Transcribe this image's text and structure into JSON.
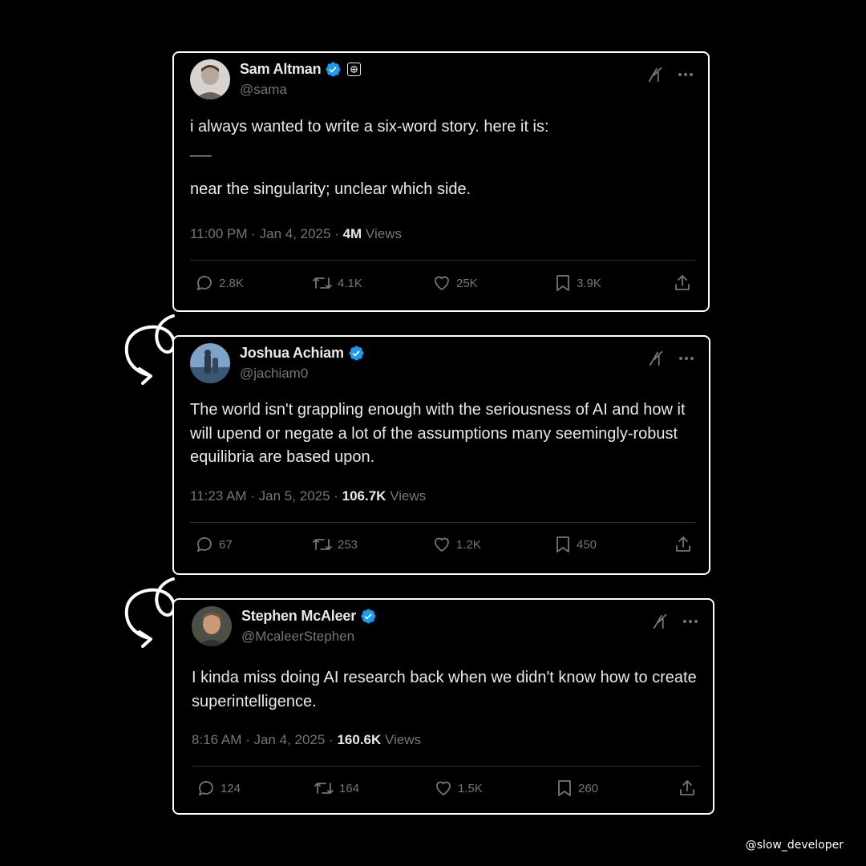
{
  "watermark": "@slow_developer",
  "tweets": [
    {
      "name": "Sam Altman",
      "handle": "@sama",
      "text_lines": [
        "i always wanted to write a six-word story. here it is:",
        "___",
        "near the singularity; unclear which side."
      ],
      "time": "11:00 PM · Jan 4, 2025 · ",
      "views_count": "4M",
      "views_label": " Views",
      "replies": "2.8K",
      "reposts": "4.1K",
      "likes": "25K",
      "bookmarks": "3.9K",
      "has_org_badge": true,
      "avatar_palette": [
        "#d9d3cf",
        "#4a3a33"
      ]
    },
    {
      "name": "Joshua Achiam",
      "handle": "@jachiam0",
      "text": "The world isn't grappling enough with the seriousness of AI and how it will upend or negate a lot of the assumptions many seemingly-robust equilibria are based upon.",
      "time": "11:23 AM · Jan 5, 2025 · ",
      "views_count": "106.7K",
      "views_label": " Views",
      "replies": "67",
      "reposts": "253",
      "likes": "1.2K",
      "bookmarks": "450",
      "avatar_palette": [
        "#5b84b3",
        "#2b3a4a"
      ]
    },
    {
      "name": "Stephen McAleer",
      "handle": "@McaleerStephen",
      "text": "I kinda miss doing AI research back when we didn't know how to create superintelligence.",
      "time": "8:16 AM · Jan 4, 2025 · ",
      "views_count": "160.6K",
      "views_label": " Views",
      "replies": "124",
      "reposts": "164",
      "likes": "1.5K",
      "bookmarks": "260",
      "avatar_palette": [
        "#4b4f45",
        "#c89a7a"
      ]
    }
  ],
  "colors": {
    "background": "#000000",
    "card_border": "#ffffff",
    "text_primary": "#e7e9ea",
    "text_secondary": "#71767b",
    "verified": "#1d9bf0",
    "divider": "#2f3336"
  },
  "icons": [
    "verified-badge-icon",
    "grok-icon",
    "more-icon",
    "reply-icon",
    "repost-icon",
    "like-icon",
    "bookmark-icon",
    "share-icon",
    "curl-arrow-icon"
  ]
}
